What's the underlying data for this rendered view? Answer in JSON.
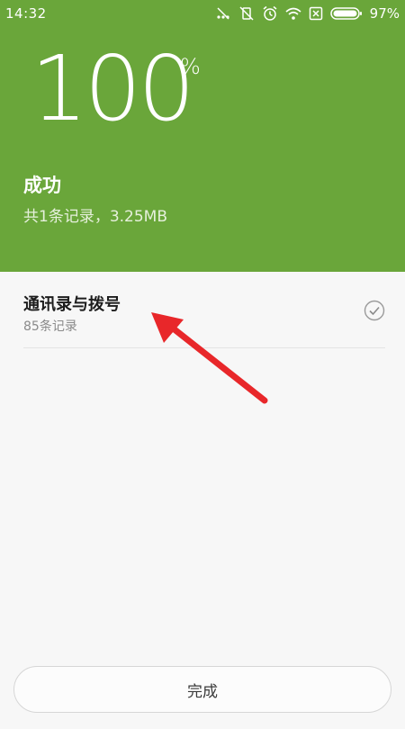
{
  "status_bar": {
    "time": "14:32",
    "battery_percent": "97%",
    "icons": [
      "signal-off-icon",
      "vibrate-off-icon",
      "alarm-icon",
      "wifi-icon",
      "sim-off-icon",
      "battery-icon"
    ]
  },
  "progress": {
    "value": "100",
    "unit": "%",
    "title": "成功",
    "subtitle": "共1条记录，3.25MB"
  },
  "items": [
    {
      "title": "通讯录与拨号",
      "subtitle": "85条记录",
      "status_icon": "check-circle-icon"
    }
  ],
  "actions": {
    "done_label": "完成"
  },
  "colors": {
    "header_bg": "#6aa63a",
    "page_bg": "#f7f7f7",
    "annotation_arrow": "#e8272a"
  }
}
